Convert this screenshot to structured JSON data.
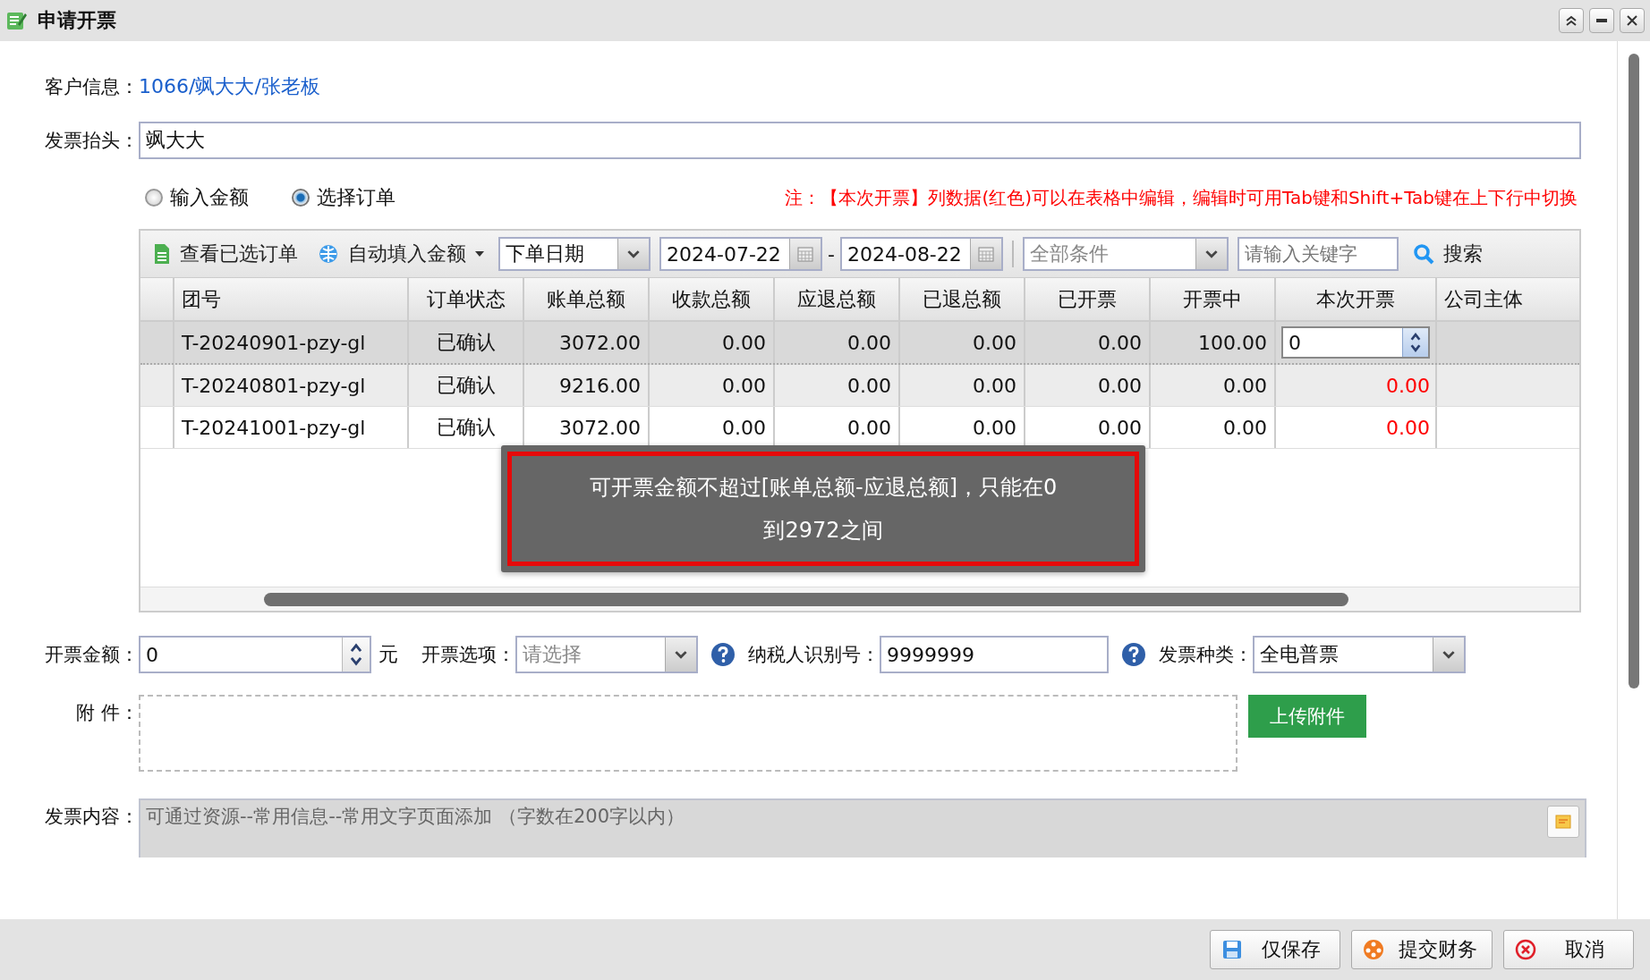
{
  "window": {
    "title": "申请开票"
  },
  "customer_info": {
    "label": "客户信息：",
    "value": "1066/飒大大/张老板"
  },
  "invoice_title": {
    "label": "发票抬头：",
    "value": "飒大大"
  },
  "modes": [
    {
      "label": "输入金额",
      "selected": false
    },
    {
      "label": "选择订单",
      "selected": true
    }
  ],
  "note": "注：【本次开票】列数据(红色)可以在表格中编辑，编辑时可用Tab键和Shift+Tab键在上下行中切换",
  "toolbar": {
    "view_selected": "查看已选订单",
    "auto_fill": "自动填入金额",
    "date_type": "下单日期",
    "date_from": "2024-07-22",
    "date_separator": "-",
    "date_to": "2024-08-22",
    "condition": "全部条件",
    "keyword_placeholder": "请输入关键字",
    "search": "搜索"
  },
  "table": {
    "columns": [
      "团号",
      "订单状态",
      "账单总额",
      "收款总额",
      "应退总额",
      "已退总额",
      "已开票",
      "开票中",
      "本次开票",
      "公司主体"
    ],
    "rows": [
      {
        "selected": true,
        "hovered": false,
        "cells": [
          "T-20240901-pzy-gl",
          "已确认",
          "3072.00",
          "0.00",
          "0.00",
          "0.00",
          "0.00",
          "100.00"
        ],
        "current": {
          "kind": "editing",
          "value": "0"
        }
      },
      {
        "selected": false,
        "hovered": true,
        "cells": [
          "T-20240801-pzy-gl",
          "已确认",
          "9216.00",
          "0.00",
          "0.00",
          "0.00",
          "0.00",
          "0.00"
        ],
        "current": {
          "kind": "value",
          "value": "0.00"
        }
      },
      {
        "selected": false,
        "hovered": false,
        "cells": [
          "T-20241001-pzy-gl",
          "已确认",
          "3072.00",
          "0.00",
          "0.00",
          "0.00",
          "0.00",
          "0.00"
        ],
        "current": {
          "kind": "value",
          "value": "0.00"
        }
      }
    ]
  },
  "toast": {
    "message": "可开票金额不超过[账单总额-应退总额]，只能在0到2972之间"
  },
  "amount": {
    "label": "开票金额：",
    "value": "0",
    "unit": "元"
  },
  "option": {
    "label": "开票选项：",
    "placeholder": "请选择"
  },
  "taxpayer_id": {
    "label": "纳税人识别号：",
    "value": "9999999"
  },
  "invoice_type": {
    "label": "发票种类：",
    "value": "全电普票"
  },
  "attachment": {
    "label": "附 件：",
    "button": "上传附件"
  },
  "content": {
    "label": "发票内容：",
    "placeholder": "可通过资源--常用信息--常用文字页面添加 （字数在200字以内）"
  },
  "buttons": [
    {
      "kind": "save",
      "label": "仅保存"
    },
    {
      "kind": "submit",
      "label": "提交财务"
    },
    {
      "kind": "cancel",
      "label": "取消"
    }
  ]
}
